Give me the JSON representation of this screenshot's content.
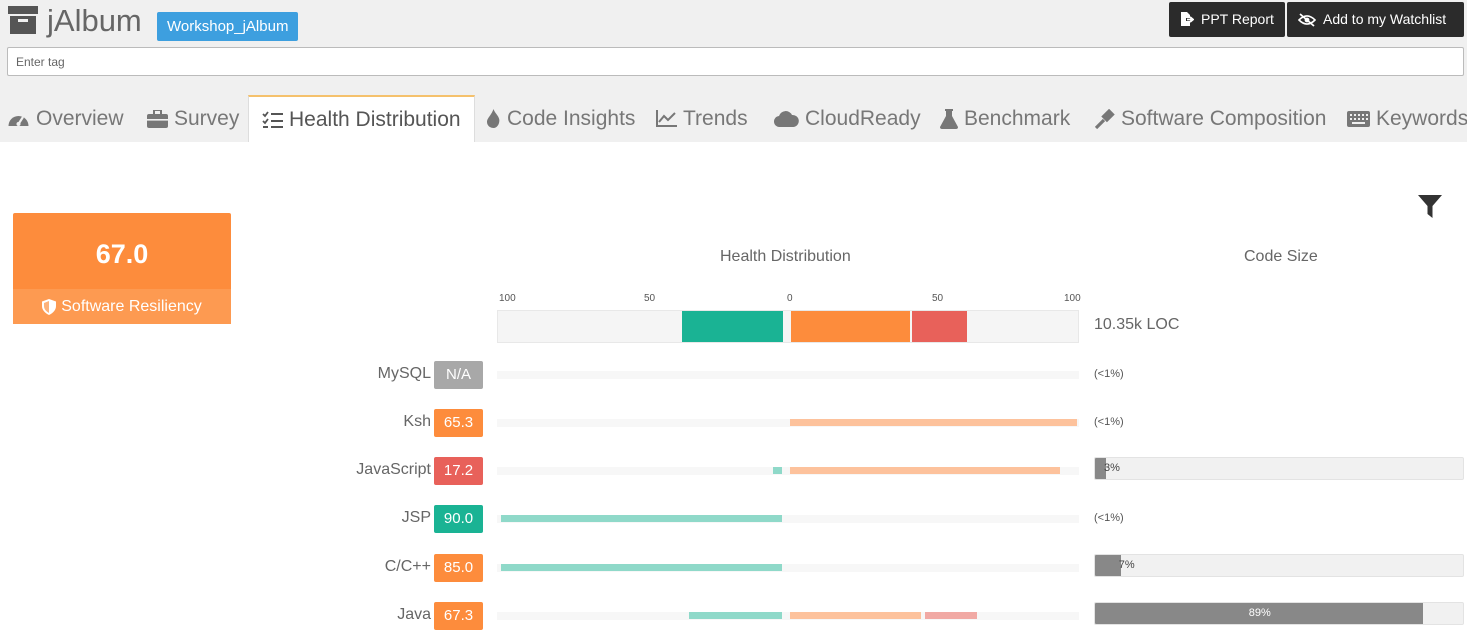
{
  "app": {
    "title": "jAlbum",
    "badge": "Workshop_jAlbum"
  },
  "header": {
    "ppt_label": "PPT Report",
    "watch_label": "Add to my Watchlist",
    "tag_placeholder": "Enter tag"
  },
  "tabs": [
    {
      "label": "Overview",
      "icon": "dashboard-icon"
    },
    {
      "label": "Survey",
      "icon": "briefcase-icon"
    },
    {
      "label": "Health Distribution",
      "icon": "checklist-icon",
      "active": true
    },
    {
      "label": "Code Insights",
      "icon": "flame-icon"
    },
    {
      "label": "Trends",
      "icon": "line-chart-icon"
    },
    {
      "label": "CloudReady",
      "icon": "cloud-icon"
    },
    {
      "label": "Benchmark",
      "icon": "flask-icon"
    },
    {
      "label": "Software Composition",
      "icon": "gavel-icon"
    },
    {
      "label": "Keywords",
      "icon": "keyboard-icon"
    }
  ],
  "score": {
    "value": "67.0",
    "label": "Software Resiliency"
  },
  "headers": {
    "health": "Health Distribution",
    "code_size": "Code Size"
  },
  "axis": {
    "ticks": [
      "100",
      "50",
      "0",
      "50",
      "100"
    ]
  },
  "summary": {
    "total_loc": "10.35k LOC",
    "good": 35,
    "medium": 41,
    "poor": 19
  },
  "colors": {
    "good": "#1ab394",
    "medium": "#fd8c3c",
    "poor": "#e8615a",
    "na": "#a8a8a8",
    "good_light": "#8fd9c9",
    "medium_light": "#fdc29c",
    "poor_light": "#f1a9a4"
  },
  "technologies": [
    {
      "name": "MySQL",
      "score": "N/A",
      "status": "na",
      "good": 0,
      "medium": 0,
      "poor": 0,
      "loc_text": "(<1%)",
      "loc_pct": null
    },
    {
      "name": "Ksh",
      "score": "65.3",
      "status": "medium",
      "good": 0,
      "medium": 99,
      "poor": 0,
      "loc_text": "(<1%)",
      "loc_pct": null
    },
    {
      "name": "JavaScript",
      "score": "17.2",
      "status": "poor",
      "good": 3,
      "medium": 93,
      "poor": 0,
      "loc_text": "3%",
      "loc_pct": 3
    },
    {
      "name": "JSP",
      "score": "90.0",
      "status": "good",
      "good": 97,
      "medium": 0,
      "poor": 0,
      "loc_text": "(<1%)",
      "loc_pct": null
    },
    {
      "name": "C/C++",
      "score": "85.0",
      "status": "medium",
      "good": 97,
      "medium": 0,
      "poor": 0,
      "loc_text": "7%",
      "loc_pct": 7
    },
    {
      "name": "Java",
      "score": "67.3",
      "status": "medium",
      "good": 32,
      "medium": 45,
      "poor": 18,
      "loc_text": "89%",
      "loc_pct": 89
    }
  ]
}
